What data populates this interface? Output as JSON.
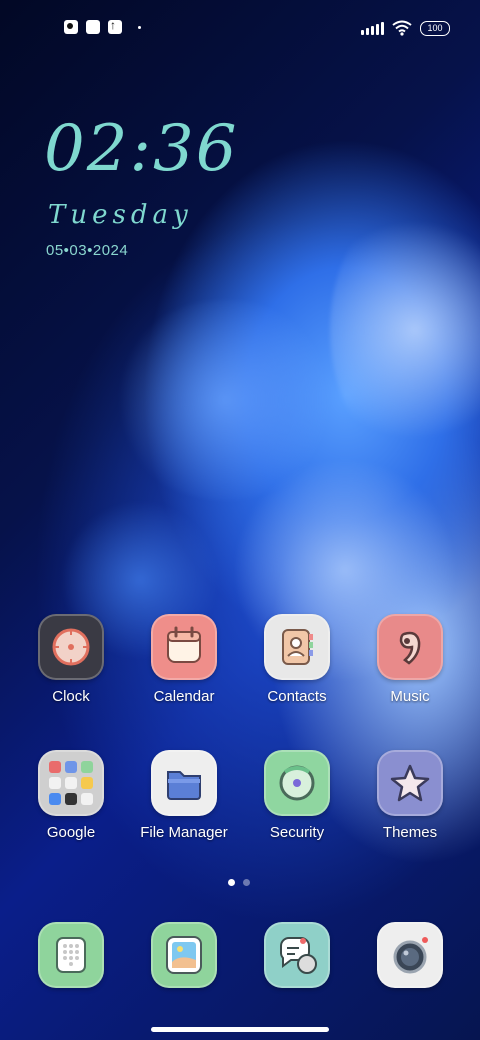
{
  "status_bar": {
    "battery": "100",
    "left_icons": [
      "app-notification-icon",
      "square-notification-icon",
      "upload-icon",
      "dot-icon"
    ],
    "right_icons": [
      "signal-icon",
      "wifi-icon",
      "battery-icon"
    ]
  },
  "widget": {
    "time": "02:36",
    "day": "Tuesday",
    "date": "05•03•2024"
  },
  "apps_row1": [
    {
      "label": "Clock",
      "icon": "clock-icon",
      "color": "#3a3a44"
    },
    {
      "label": "Calendar",
      "icon": "calendar-icon",
      "color": "#ef8e8a"
    },
    {
      "label": "Contacts",
      "icon": "contacts-icon",
      "color": "#e8e8e8"
    },
    {
      "label": "Music",
      "icon": "music-icon",
      "color": "#e88a8a"
    }
  ],
  "apps_row2": [
    {
      "label": "Google",
      "icon": "google-folder-icon",
      "color": "#cfcfcf"
    },
    {
      "label": "File Manager",
      "icon": "folder-icon",
      "color": "#eeeeee"
    },
    {
      "label": "Security",
      "icon": "security-icon",
      "color": "#8fd6a0"
    },
    {
      "label": "Themes",
      "icon": "star-icon",
      "color": "#8a8fd0"
    }
  ],
  "dock": [
    {
      "icon": "dialer-icon",
      "color": "#8fd49c"
    },
    {
      "icon": "gallery-icon",
      "color": "#8fd49c"
    },
    {
      "icon": "messages-icon",
      "color": "#8fd0c8"
    },
    {
      "icon": "camera-icon",
      "color": "#eeeeee"
    }
  ],
  "pager": {
    "pages": 2,
    "current": 1
  }
}
